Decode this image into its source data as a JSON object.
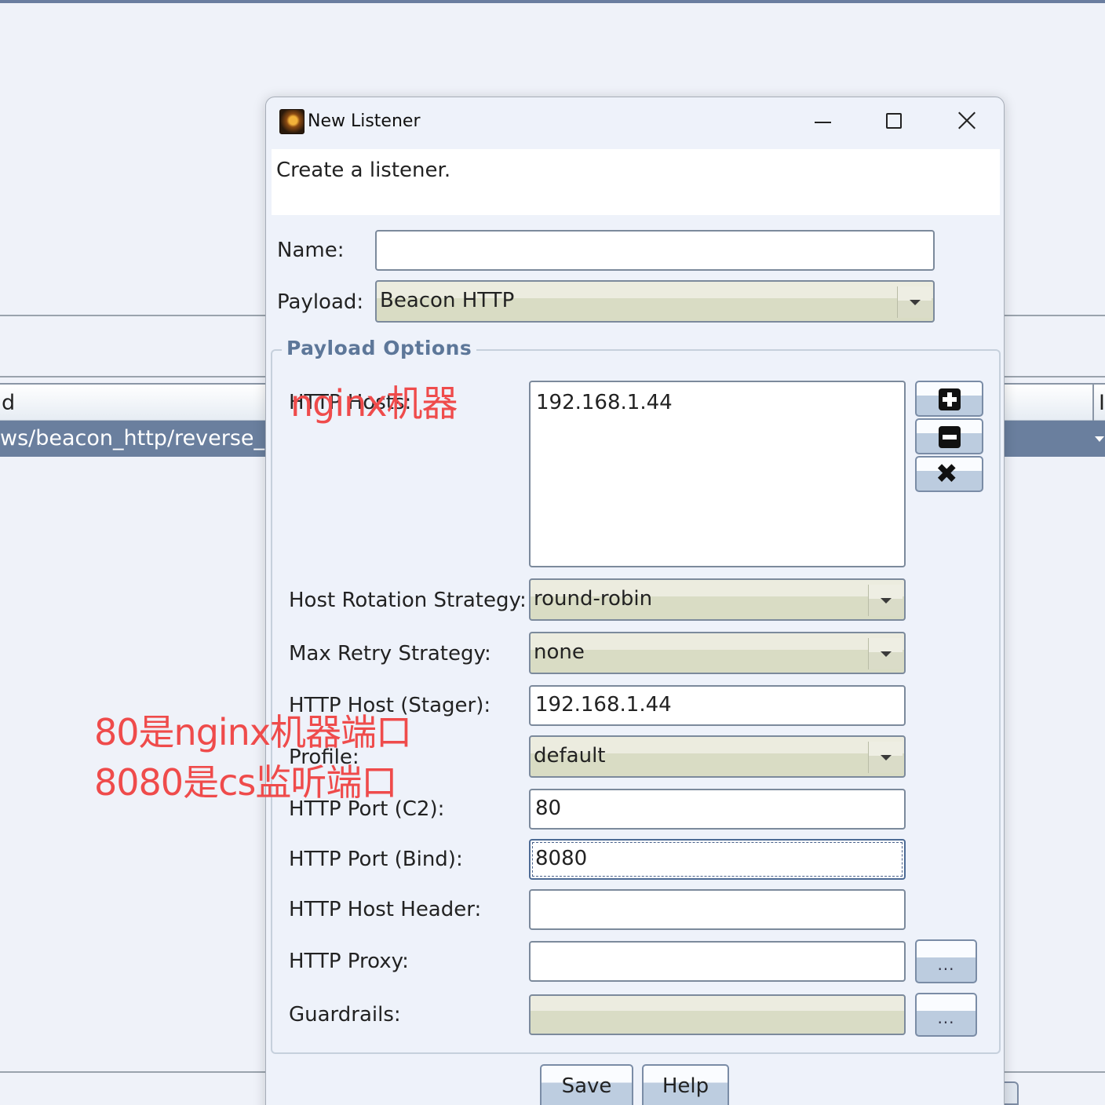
{
  "background": {
    "table_header_left": "d",
    "selected_row_text": "ws/beacon_http/reverse_http",
    "table_header_right": "I"
  },
  "dialog": {
    "title": "New Listener",
    "description": "Create a listener.",
    "name_label": "Name:",
    "name_value": "",
    "payload_label": "Payload:",
    "payload_value": "Beacon HTTP",
    "options_legend": "Payload Options",
    "hosts_label": "HTTP Hosts:",
    "hosts": [
      "192.168.1.44"
    ],
    "host_rotation_label": "Host Rotation Strategy:",
    "host_rotation_value": "round-robin",
    "max_retry_label": "Max Retry Strategy:",
    "max_retry_value": "none",
    "stager_host_label": "HTTP Host (Stager):",
    "stager_host_value": "192.168.1.44",
    "profile_label": "Profile:",
    "profile_value": "default",
    "port_c2_label": "HTTP Port (C2):",
    "port_c2_value": "80",
    "port_bind_label": "HTTP Port (Bind):",
    "port_bind_value": "8080",
    "host_header_label": "HTTP Host Header:",
    "host_header_value": "",
    "proxy_label": "HTTP Proxy:",
    "proxy_value": "",
    "guardrails_label": "Guardrails:",
    "guardrails_value": "",
    "dots_label": "...",
    "save_label": "Save",
    "help_label": "Help"
  },
  "annotations": {
    "nginx_machine": "nginx机器",
    "port_note_line1": "80是nginx机器端口",
    "port_note_line2": "8080是cs监听端口"
  },
  "colors": {
    "annotation": "#ef4b4b",
    "selected_row": "#6a7f9e",
    "legend": "#5d7799"
  }
}
